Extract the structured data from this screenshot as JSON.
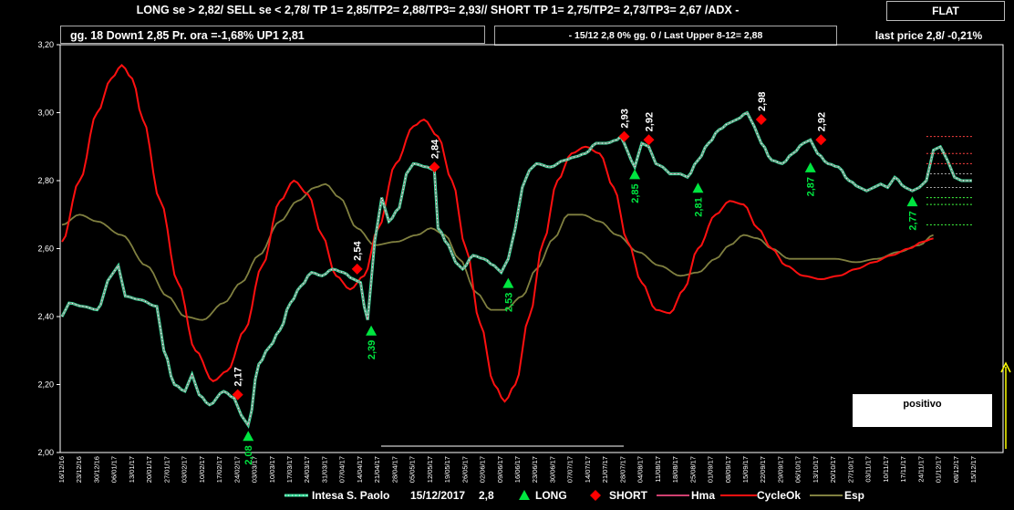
{
  "header": {
    "text": "LONG se > 2,82/  SELL se < 2,78/ TP 1= 2,85/TP2= 2,88/TP3= 2,93//   SHORT TP 1= 2,75/TP2= 2,73/TP3= 2,67 /ADX -",
    "flat_label": "FLAT"
  },
  "info_bar": {
    "left_text": "gg. 18  Down1  2,85  Pr. ora =-1,68%   UP1 2,81",
    "right_text": "-  15/12  2,8  0%  gg. 0 / Last Upper 8-12= 2,88",
    "last_price": "last price 2,8/ -0,21%"
  },
  "positivo_label": "positivo",
  "colors": {
    "price": "#40e0a0",
    "price_dots": "#ffffff",
    "long": "#00e640",
    "short": "#ff0000",
    "hma": "#d04070",
    "cycleok": "#ff1010",
    "esp": "#808040",
    "axis_text": "#ffffff",
    "arrow": "#ffff00"
  },
  "chart_data": {
    "type": "line",
    "title": "",
    "xlabel": "",
    "ylabel": "",
    "ylim": [
      2.0,
      3.2
    ],
    "yticks": [
      "2,00",
      "2,20",
      "2,40",
      "2,60",
      "2,80",
      "3,00",
      "3,20"
    ],
    "x_count": 260,
    "xtick_labels": [
      "16/12/16",
      "23/12/16",
      "30/12/16",
      "06/01/17",
      "13/01/17",
      "20/01/17",
      "27/01/17",
      "03/02/17",
      "10/02/17",
      "17/02/17",
      "24/02/17",
      "03/03/17",
      "10/03/17",
      "17/03/17",
      "24/03/17",
      "31/03/17",
      "07/04/17",
      "14/04/17",
      "21/04/17",
      "28/04/17",
      "05/05/17",
      "12/05/17",
      "19/05/17",
      "26/05/17",
      "02/06/17",
      "09/06/17",
      "16/06/17",
      "23/06/17",
      "30/06/17",
      "07/07/17",
      "14/07/17",
      "21/07/17",
      "28/07/17",
      "04/08/17",
      "11/08/17",
      "18/08/17",
      "25/08/17",
      "01/09/17",
      "08/09/17",
      "15/09/17",
      "22/09/17",
      "29/09/17",
      "06/10/17",
      "13/10/17",
      "20/10/17",
      "27/10/17",
      "03/11/17",
      "10/11/17",
      "17/11/17",
      "24/11/17",
      "01/12/17",
      "08/12/17",
      "15/12/17"
    ],
    "legend": [
      "Intesa S. Paolo",
      "15/12/2017",
      "2,8",
      "LONG",
      "SHORT",
      "Hma",
      "CycleOk",
      "Esp"
    ],
    "price_keys": [
      [
        0,
        2.4
      ],
      [
        2,
        2.44
      ],
      [
        6,
        2.43
      ],
      [
        10,
        2.42
      ],
      [
        14,
        2.52
      ],
      [
        16,
        2.55
      ],
      [
        18,
        2.46
      ],
      [
        22,
        2.45
      ],
      [
        27,
        2.43
      ],
      [
        29,
        2.3
      ],
      [
        32,
        2.2
      ],
      [
        35,
        2.18
      ],
      [
        37,
        2.23
      ],
      [
        39,
        2.17
      ],
      [
        42,
        2.14
      ],
      [
        46,
        2.18
      ],
      [
        49,
        2.16
      ],
      [
        51,
        2.11
      ],
      [
        53,
        2.08
      ],
      [
        56,
        2.26
      ],
      [
        59,
        2.31
      ],
      [
        62,
        2.36
      ],
      [
        65,
        2.44
      ],
      [
        68,
        2.49
      ],
      [
        71,
        2.53
      ],
      [
        74,
        2.52
      ],
      [
        77,
        2.54
      ],
      [
        80,
        2.53
      ],
      [
        83,
        2.51
      ],
      [
        85,
        2.5
      ],
      [
        86,
        2.43
      ],
      [
        87,
        2.39
      ],
      [
        89,
        2.62
      ],
      [
        91,
        2.75
      ],
      [
        93,
        2.68
      ],
      [
        96,
        2.72
      ],
      [
        98,
        2.82
      ],
      [
        100,
        2.85
      ],
      [
        104,
        2.84
      ],
      [
        106,
        2.83
      ],
      [
        107,
        2.66
      ],
      [
        110,
        2.61
      ],
      [
        112,
        2.56
      ],
      [
        114,
        2.54
      ],
      [
        117,
        2.58
      ],
      [
        120,
        2.57
      ],
      [
        123,
        2.55
      ],
      [
        125,
        2.53
      ],
      [
        127,
        2.57
      ],
      [
        129,
        2.66
      ],
      [
        131,
        2.78
      ],
      [
        133,
        2.83
      ],
      [
        135,
        2.85
      ],
      [
        139,
        2.84
      ],
      [
        143,
        2.86
      ],
      [
        146,
        2.87
      ],
      [
        149,
        2.88
      ],
      [
        152,
        2.91
      ],
      [
        155,
        2.91
      ],
      [
        158,
        2.92
      ],
      [
        159,
        2.93
      ],
      [
        160,
        2.91
      ],
      [
        162,
        2.86
      ],
      [
        163,
        2.84
      ],
      [
        165,
        2.91
      ],
      [
        167,
        2.9
      ],
      [
        169,
        2.85
      ],
      [
        171,
        2.84
      ],
      [
        173,
        2.82
      ],
      [
        176,
        2.82
      ],
      [
        178,
        2.81
      ],
      [
        181,
        2.86
      ],
      [
        184,
        2.91
      ],
      [
        187,
        2.95
      ],
      [
        190,
        2.97
      ],
      [
        192,
        2.98
      ],
      [
        195,
        3.0
      ],
      [
        197,
        2.96
      ],
      [
        199,
        2.91
      ],
      [
        202,
        2.86
      ],
      [
        205,
        2.85
      ],
      [
        208,
        2.88
      ],
      [
        211,
        2.91
      ],
      [
        213,
        2.92
      ],
      [
        215,
        2.88
      ],
      [
        218,
        2.85
      ],
      [
        221,
        2.84
      ],
      [
        224,
        2.8
      ],
      [
        227,
        2.78
      ],
      [
        229,
        2.77
      ],
      [
        231,
        2.78
      ],
      [
        233,
        2.79
      ],
      [
        235,
        2.78
      ],
      [
        237,
        2.81
      ],
      [
        240,
        2.78
      ],
      [
        242,
        2.77
      ],
      [
        244,
        2.78
      ],
      [
        246,
        2.8
      ],
      [
        248,
        2.89
      ],
      [
        250,
        2.9
      ],
      [
        252,
        2.86
      ],
      [
        254,
        2.81
      ],
      [
        256,
        2.8
      ],
      [
        259,
        2.8
      ]
    ],
    "cycleok_keys": [
      [
        0,
        2.62
      ],
      [
        5,
        2.8
      ],
      [
        10,
        3.0
      ],
      [
        14,
        3.1
      ],
      [
        17,
        3.14
      ],
      [
        20,
        3.1
      ],
      [
        23,
        2.98
      ],
      [
        28,
        2.74
      ],
      [
        33,
        2.5
      ],
      [
        38,
        2.3
      ],
      [
        43,
        2.21
      ],
      [
        47,
        2.24
      ],
      [
        52,
        2.36
      ],
      [
        57,
        2.55
      ],
      [
        62,
        2.74
      ],
      [
        66,
        2.8
      ],
      [
        70,
        2.76
      ],
      [
        74,
        2.64
      ],
      [
        78,
        2.52
      ],
      [
        82,
        2.48
      ],
      [
        86,
        2.52
      ],
      [
        90,
        2.66
      ],
      [
        95,
        2.85
      ],
      [
        100,
        2.96
      ],
      [
        103,
        2.98
      ],
      [
        107,
        2.93
      ],
      [
        111,
        2.8
      ],
      [
        115,
        2.6
      ],
      [
        119,
        2.38
      ],
      [
        123,
        2.2
      ],
      [
        126,
        2.15
      ],
      [
        129,
        2.2
      ],
      [
        133,
        2.4
      ],
      [
        137,
        2.62
      ],
      [
        141,
        2.8
      ],
      [
        145,
        2.88
      ],
      [
        149,
        2.9
      ],
      [
        153,
        2.88
      ],
      [
        157,
        2.78
      ],
      [
        161,
        2.62
      ],
      [
        165,
        2.5
      ],
      [
        169,
        2.42
      ],
      [
        173,
        2.41
      ],
      [
        177,
        2.48
      ],
      [
        181,
        2.6
      ],
      [
        186,
        2.7
      ],
      [
        190,
        2.74
      ],
      [
        194,
        2.73
      ],
      [
        198,
        2.66
      ],
      [
        202,
        2.6
      ],
      [
        206,
        2.55
      ],
      [
        211,
        2.52
      ],
      [
        216,
        2.51
      ],
      [
        221,
        2.52
      ],
      [
        226,
        2.54
      ],
      [
        231,
        2.56
      ],
      [
        236,
        2.58
      ],
      [
        241,
        2.6
      ],
      [
        245,
        2.62
      ],
      [
        248,
        2.63
      ]
    ],
    "esp_keys": [
      [
        0,
        2.67
      ],
      [
        5,
        2.7
      ],
      [
        10,
        2.68
      ],
      [
        17,
        2.64
      ],
      [
        24,
        2.55
      ],
      [
        30,
        2.46
      ],
      [
        35,
        2.4
      ],
      [
        40,
        2.39
      ],
      [
        46,
        2.44
      ],
      [
        51,
        2.5
      ],
      [
        56,
        2.58
      ],
      [
        62,
        2.68
      ],
      [
        67,
        2.74
      ],
      [
        72,
        2.78
      ],
      [
        75,
        2.79
      ],
      [
        79,
        2.75
      ],
      [
        84,
        2.66
      ],
      [
        89,
        2.61
      ],
      [
        95,
        2.62
      ],
      [
        101,
        2.64
      ],
      [
        105,
        2.66
      ],
      [
        109,
        2.64
      ],
      [
        113,
        2.57
      ],
      [
        118,
        2.47
      ],
      [
        122,
        2.42
      ],
      [
        126,
        2.42
      ],
      [
        131,
        2.46
      ],
      [
        135,
        2.54
      ],
      [
        140,
        2.63
      ],
      [
        144,
        2.7
      ],
      [
        148,
        2.7
      ],
      [
        153,
        2.68
      ],
      [
        158,
        2.64
      ],
      [
        164,
        2.59
      ],
      [
        170,
        2.55
      ],
      [
        176,
        2.52
      ],
      [
        181,
        2.53
      ],
      [
        186,
        2.57
      ],
      [
        190,
        2.61
      ],
      [
        194,
        2.64
      ],
      [
        198,
        2.63
      ],
      [
        202,
        2.6
      ],
      [
        207,
        2.57
      ],
      [
        214,
        2.57
      ],
      [
        220,
        2.57
      ],
      [
        226,
        2.56
      ],
      [
        232,
        2.57
      ],
      [
        238,
        2.59
      ],
      [
        244,
        2.61
      ],
      [
        248,
        2.64
      ]
    ],
    "long_signals": [
      {
        "x": 53,
        "y": 2.08,
        "label": "2,08"
      },
      {
        "x": 88,
        "y": 2.39,
        "label": "2,39"
      },
      {
        "x": 127,
        "y": 2.53,
        "label": "2,53"
      },
      {
        "x": 163,
        "y": 2.85,
        "label": "2,85"
      },
      {
        "x": 181,
        "y": 2.81,
        "label": "2,81"
      },
      {
        "x": 213,
        "y": 2.87,
        "label": "2,87"
      },
      {
        "x": 242,
        "y": 2.77,
        "label": "2,77"
      }
    ],
    "short_signals": [
      {
        "x": 50,
        "y": 2.17,
        "label": "2,17"
      },
      {
        "x": 84,
        "y": 2.54,
        "label": "2,54"
      },
      {
        "x": 106,
        "y": 2.84,
        "label": "2,84"
      },
      {
        "x": 160,
        "y": 2.93,
        "label": "2,93"
      },
      {
        "x": 167,
        "y": 2.92,
        "label": "2,92"
      },
      {
        "x": 199,
        "y": 2.98,
        "label": "2,98"
      },
      {
        "x": 216,
        "y": 2.92,
        "label": "2,92"
      }
    ]
  }
}
